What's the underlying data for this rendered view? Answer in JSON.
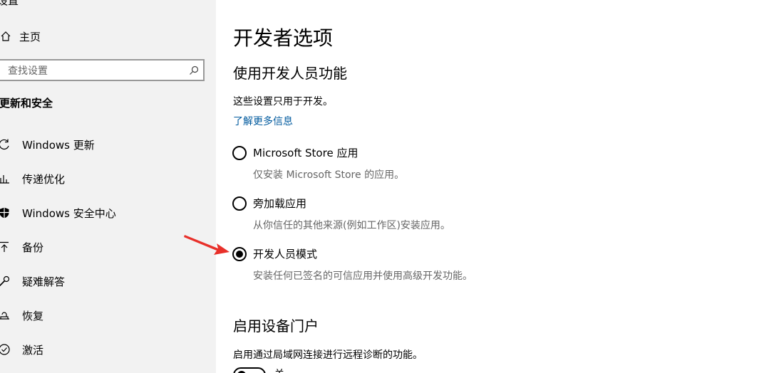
{
  "sidebar": {
    "top_text": "设置",
    "home_label": "主页",
    "search_placeholder": "查找设置",
    "section_title": "更新和安全",
    "items": [
      {
        "label": "Windows 更新",
        "icon": "sync-icon"
      },
      {
        "label": "传递优化",
        "icon": "delivery-optimization-icon"
      },
      {
        "label": "Windows 安全中心",
        "icon": "shield-icon"
      },
      {
        "label": "备份",
        "icon": "backup-arrow-icon"
      },
      {
        "label": "疑难解答",
        "icon": "wrench-icon"
      },
      {
        "label": "恢复",
        "icon": "recovery-icon"
      },
      {
        "label": "激活",
        "icon": "check-circle-icon"
      }
    ]
  },
  "main": {
    "title": "开发者选项",
    "dev_features": {
      "heading": "使用开发人员功能",
      "description": "这些设置只用于开发。",
      "learn_more": "了解更多信息",
      "options": [
        {
          "label": "Microsoft Store 应用",
          "desc": "仅安装 Microsoft Store 的应用。",
          "checked": false
        },
        {
          "label": "旁加载应用",
          "desc": "从你信任的其他来源(例如工作区)安装应用。",
          "checked": false
        },
        {
          "label": "开发人员模式",
          "desc": "安装任何已签名的可信应用并使用高级开发功能。",
          "checked": true
        }
      ]
    },
    "device_portal": {
      "heading": "启用设备门户",
      "description": "启用通过局域网连接进行远程诊断的功能。",
      "toggle_label": "关"
    }
  },
  "colors": {
    "sidebar_bg": "#f2f2f2",
    "link": "#005a9e",
    "annotation_arrow": "#e8302a"
  }
}
